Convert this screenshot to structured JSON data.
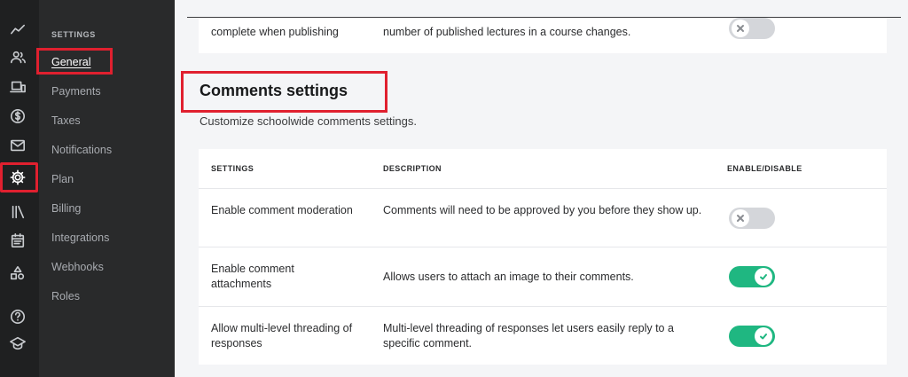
{
  "rail": {
    "icons": [
      "trend-icon",
      "users-icon",
      "devices-icon",
      "dollar-icon",
      "mail-icon",
      "gear-icon",
      "library-icon",
      "calendar-icon",
      "shapes-icon",
      "help-icon",
      "graduation-cap-icon"
    ],
    "active": "gear-icon"
  },
  "sidebar": {
    "heading": "SETTINGS",
    "items": [
      {
        "label": "General"
      },
      {
        "label": "Payments"
      },
      {
        "label": "Taxes"
      },
      {
        "label": "Notifications"
      },
      {
        "label": "Plan"
      },
      {
        "label": "Billing"
      },
      {
        "label": "Integrations"
      },
      {
        "label": "Webhooks"
      },
      {
        "label": "Roles"
      }
    ],
    "active_index": 0
  },
  "previous_section": {
    "row_name": "complete when publishing",
    "row_description": "number of published lectures in a course changes.",
    "toggle": "off"
  },
  "section": {
    "title": "Comments settings",
    "subtitle": "Customize schoolwide comments settings."
  },
  "table": {
    "headers": {
      "settings": "SETTINGS",
      "description": "DESCRIPTION",
      "enable": "ENABLE/DISABLE"
    },
    "rows": [
      {
        "name": "Enable comment moderation",
        "description": "Comments will need to be approved by you before they show up.",
        "enabled": false
      },
      {
        "name": "Enable comment attachments",
        "description": "Allows users to attach an image to their comments.",
        "enabled": true
      },
      {
        "name": "Allow multi-level threading of responses",
        "description": "Multi-level threading of responses let users easily reply to a specific comment.",
        "enabled": true
      }
    ]
  },
  "colors": {
    "highlight": "#e0202f",
    "toggle_on": "#1fb781",
    "toggle_off": "#d4d6da",
    "rail_bg": "#1f2021",
    "sidebar_bg": "#292a2b"
  }
}
